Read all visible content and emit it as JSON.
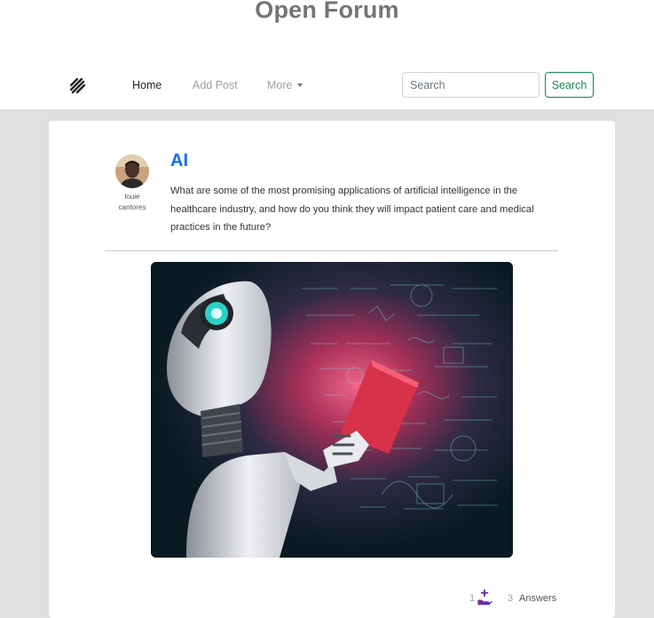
{
  "site": {
    "title": "Open Forum"
  },
  "nav": {
    "items": [
      {
        "label": "Home"
      },
      {
        "label": "Add Post"
      },
      {
        "label": "More"
      }
    ],
    "search": {
      "placeholder": "Search",
      "button_label": "Search"
    }
  },
  "post": {
    "author": {
      "first_name": "louie",
      "last_name": "cantores"
    },
    "title": "AI",
    "body": "What are some of the most promising applications of artificial intelligence in the healthcare industry, and how do you think they will impact patient care and medical practices in the future?",
    "likes": "1",
    "answers_count": "3",
    "answers_label": "Answers"
  },
  "colors": {
    "title_link": "#0d6efd",
    "search_button": "#198754",
    "like_icon": "#6f2da8",
    "page_background": "#e0e0df"
  },
  "icons": {
    "brand": "stripes-logo-icon",
    "more_caret": "caret-down-icon",
    "like": "hand-plus-icon"
  }
}
